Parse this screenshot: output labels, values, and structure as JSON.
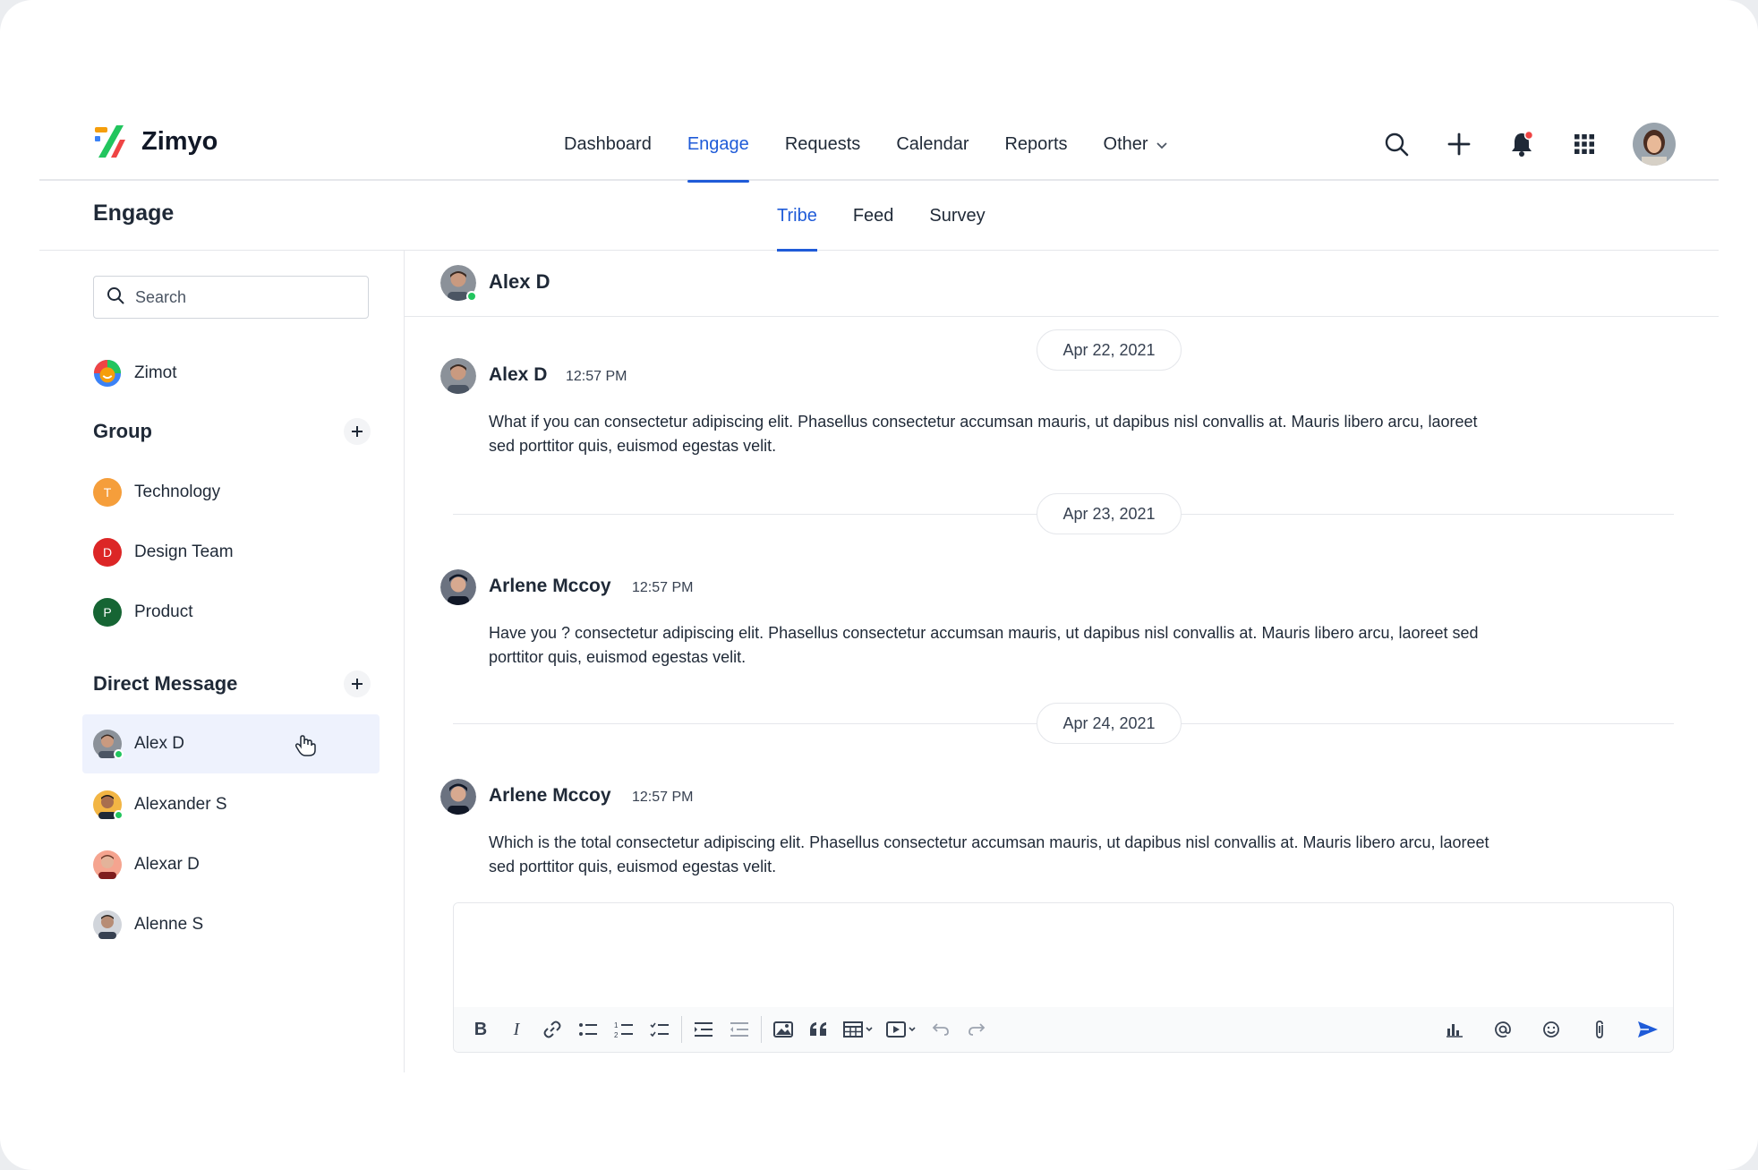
{
  "brand": {
    "name": "Zimyo"
  },
  "nav": {
    "links": [
      "Dashboard",
      "Engage",
      "Requests",
      "Calendar",
      "Reports",
      "Other"
    ],
    "active": "Engage"
  },
  "page": {
    "title": "Engage"
  },
  "subtabs": {
    "items": [
      "Tribe",
      "Feed",
      "Survey"
    ],
    "active": "Tribe"
  },
  "sidebar": {
    "search_placeholder": "Search",
    "company": "Zimot",
    "group_title": "Group",
    "groups": [
      {
        "initial": "T",
        "label": "Technology",
        "color": "#f59e3b"
      },
      {
        "initial": "D",
        "label": "Design Team",
        "color": "#dc2626"
      },
      {
        "initial": "P",
        "label": "Product",
        "color": "#166534"
      }
    ],
    "dm_title": "Direct Message",
    "dms": [
      {
        "label": "Alex D",
        "online": true,
        "selected": true
      },
      {
        "label": "Alexander S",
        "online": true,
        "selected": false
      },
      {
        "label": "Alexar D",
        "online": false,
        "selected": false
      },
      {
        "label": "Alenne S",
        "online": false,
        "selected": false
      }
    ]
  },
  "chat": {
    "header_name": "Alex D",
    "dates": [
      "Apr 22, 2021",
      "Apr 23, 2021",
      "Apr 24, 2021"
    ],
    "messages": [
      {
        "author": "Alex D",
        "time": "12:57 PM",
        "text": "What if you can consectetur adipiscing elit. Phasellus consectetur accumsan mauris, ut dapibus nisl convallis at. Mauris libero arcu, laoreet sed porttitor quis, euismod egestas velit."
      },
      {
        "author": "Arlene Mccoy",
        "time": "12:57 PM",
        "text": "Have you ? consectetur adipiscing elit. Phasellus consectetur accumsan mauris, ut dapibus nisl convallis at. Mauris libero arcu, laoreet sed porttitor quis, euismod egestas velit."
      },
      {
        "author": "Arlene Mccoy",
        "time": "12:57 PM",
        "text": "Which is the total consectetur adipiscing elit. Phasellus consectetur accumsan mauris, ut dapibus nisl convallis at. Mauris libero arcu, laoreet sed porttitor quis, euismod egestas velit."
      }
    ]
  },
  "composer": {
    "value": ""
  },
  "colors": {
    "accent": "#1f5bd8",
    "online": "#22c55e",
    "notification": "#ef4444"
  }
}
